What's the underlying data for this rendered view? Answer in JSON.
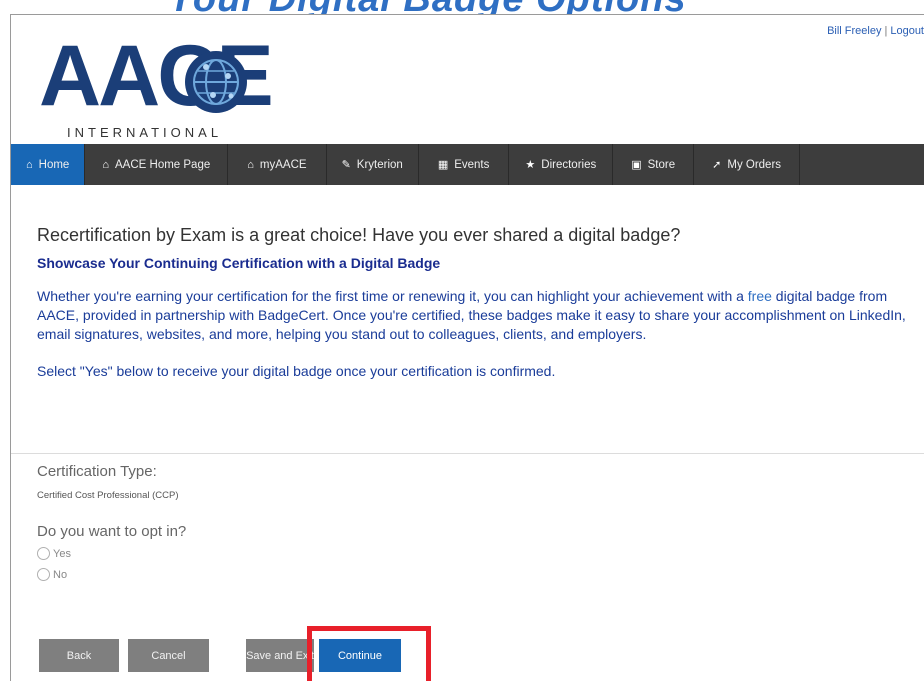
{
  "header": {
    "banner_text": "Your Digital Badge Options",
    "user_name": "Bill Freeley",
    "separator": "|",
    "logout_label": "Logout",
    "logo": {
      "letters": "AACE",
      "subtitle": "INTERNATIONAL"
    }
  },
  "nav": {
    "items": [
      {
        "label": "Home",
        "icon": "home-icon",
        "active": true
      },
      {
        "label": "AACE Home Page",
        "icon": "home-icon",
        "active": false
      },
      {
        "label": "myAACE",
        "icon": "home-icon",
        "active": false
      },
      {
        "label": "Kryterion",
        "icon": "edit-icon",
        "active": false
      },
      {
        "label": "Events",
        "icon": "calendar-icon",
        "active": false
      },
      {
        "label": "Directories",
        "icon": "star-icon",
        "active": false
      },
      {
        "label": "Store",
        "icon": "cart-icon",
        "active": false
      },
      {
        "label": "My Orders",
        "icon": "pin-icon",
        "active": false
      }
    ]
  },
  "main": {
    "headline": "Recertification by Exam is a great choice! Have you ever shared a digital badge?",
    "subhead": "Showcase Your Continuing Certification with a Digital Badge",
    "para_before_free": "Whether you're earning your certification for the first time or renewing it, you can highlight your achievement with a ",
    "free_word": "free",
    "para_after_free": " digital badge from AACE, provided in partnership with BadgeCert. Once you're certified, these badges make it easy to share your accomplishment on LinkedIn, email signatures, websites, and more, helping you stand out to colleagues, clients, and employers.",
    "select_note": "Select \"Yes\" below to receive your digital badge once your certification is confirmed."
  },
  "form": {
    "cert_type_label": "Certification Type:",
    "cert_type_value": "Certified Cost Professional (CCP)",
    "opt_in_question": "Do you want to opt in?",
    "options": [
      "Yes",
      "No"
    ]
  },
  "buttons": {
    "back": "Back",
    "cancel": "Cancel",
    "save_exit": "Save and Exit",
    "continue": "Continue"
  },
  "colors": {
    "nav_bg": "#3d3d3d",
    "nav_active": "#1867b5",
    "continue_button": "#1867b5",
    "secondary_button": "#7f7f7f",
    "body_text_blue": "#1a3c99",
    "highlight_red": "#e8202a"
  }
}
